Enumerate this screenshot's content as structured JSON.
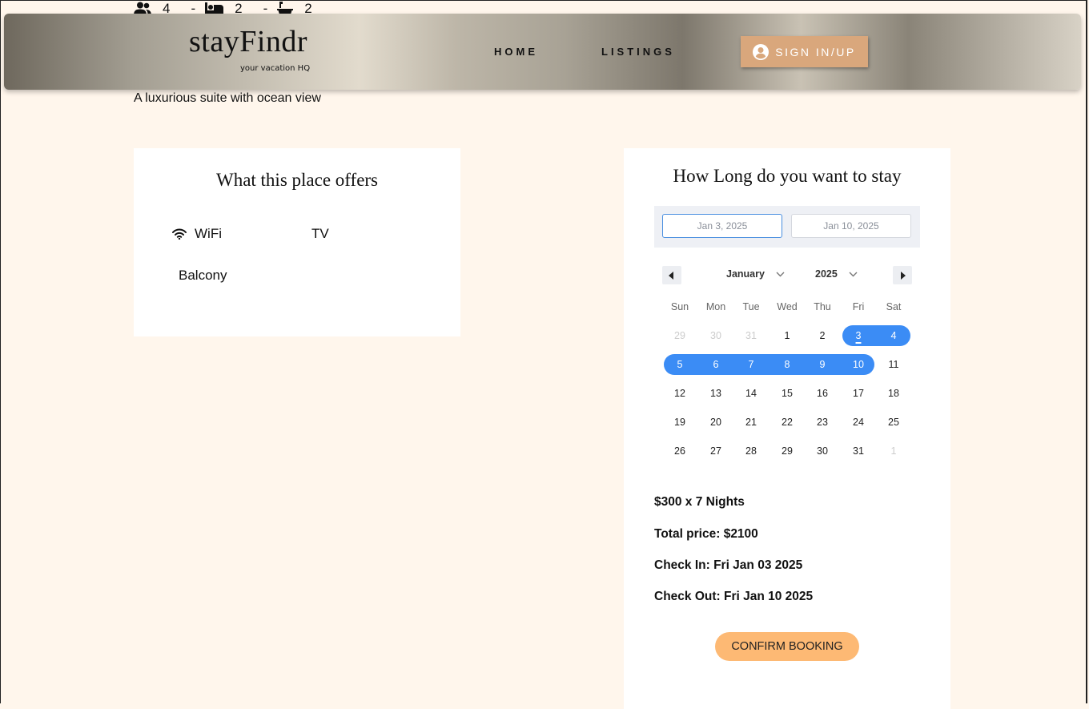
{
  "stats": {
    "guests": "4",
    "bedrooms": "2",
    "bathrooms": "2",
    "separator": "-"
  },
  "header": {
    "logo": "stayFindr",
    "tagline": "your vacation HQ",
    "nav": {
      "home": "HOME",
      "listings": "LISTINGS"
    },
    "signin_label": "SIGN IN/UP"
  },
  "listing": {
    "description": "A luxurious suite with ocean view"
  },
  "amenities": {
    "title": "What this place offers",
    "items": [
      {
        "label": "WiFi",
        "icon": "wifi-icon"
      },
      {
        "label": "TV"
      },
      {
        "label": "Balcony"
      }
    ]
  },
  "booking": {
    "title": "How Long do you want to stay",
    "start_date": "Jan 3, 2025",
    "end_date": "Jan 10, 2025",
    "month": "January",
    "year": "2025",
    "weekdays": [
      "Sun",
      "Mon",
      "Tue",
      "Wed",
      "Thu",
      "Fri",
      "Sat"
    ],
    "weeks": [
      [
        "29",
        "30",
        "31",
        "1",
        "2",
        "3",
        "4"
      ],
      [
        "5",
        "6",
        "7",
        "8",
        "9",
        "10",
        "11"
      ],
      [
        "12",
        "13",
        "14",
        "15",
        "16",
        "17",
        "18"
      ],
      [
        "19",
        "20",
        "21",
        "22",
        "23",
        "24",
        "25"
      ],
      [
        "26",
        "27",
        "28",
        "29",
        "30",
        "31",
        "1"
      ]
    ],
    "price_line": "$300 x 7 Nights",
    "total_line": "Total price: $2100",
    "checkin_line": "Check In: Fri Jan 03 2025",
    "checkout_line": "Check Out: Fri Jan 10 2025",
    "confirm_label": "CONFIRM BOOKING",
    "accent_color": "#3b8cf5"
  }
}
